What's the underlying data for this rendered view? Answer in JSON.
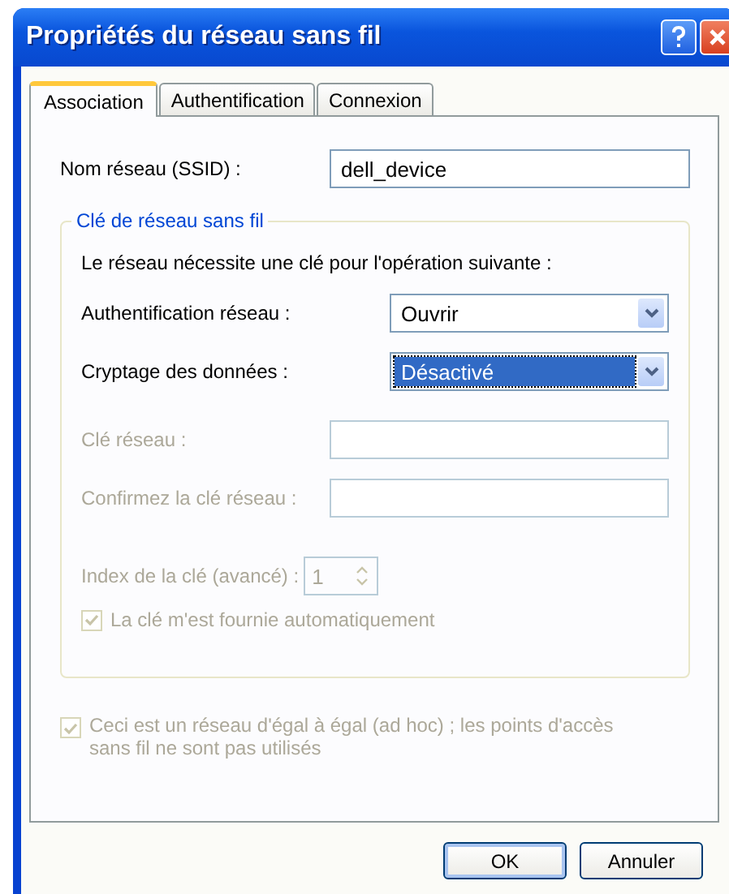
{
  "window": {
    "title": "Propriétés du réseau sans fil"
  },
  "tabs": [
    {
      "label": "Association",
      "selected": true
    },
    {
      "label": "Authentification",
      "selected": false
    },
    {
      "label": "Connexion",
      "selected": false
    }
  ],
  "ssid": {
    "label": "Nom réseau (SSID) :",
    "value": "dell_device"
  },
  "key_group": {
    "legend": "Clé de réseau sans fil",
    "sentence": "Le réseau nécessite une clé pour l'opération suivante :",
    "rows": [
      {
        "kind": "dropdown",
        "label": "Authentification réseau :",
        "value": "Ouvrir",
        "selected": false,
        "disabled": false
      },
      {
        "kind": "dropdown",
        "label": "Cryptage des données :",
        "value": "Désactivé",
        "selected": true,
        "disabled": false
      },
      {
        "kind": "field",
        "label": "Clé réseau :",
        "disabled": true
      },
      {
        "kind": "field",
        "label": "Confirmez la clé réseau :",
        "disabled": true
      },
      {
        "kind": "spinner",
        "label": "Index de la clé (avancé) :",
        "value": "1",
        "disabled": true
      },
      {
        "kind": "checkbox",
        "label": "La clé m'est fournie automatiquement",
        "checked": true,
        "disabled": true
      }
    ]
  },
  "adhoc": {
    "label": "Ceci est un réseau d'égal à égal (ad hoc) ; les points d'accès sans fil ne sont pas utilisés",
    "checked": true,
    "disabled": true
  },
  "buttons": [
    {
      "label": "OK",
      "default": true
    },
    {
      "label": "Annuler",
      "default": false
    }
  ]
}
